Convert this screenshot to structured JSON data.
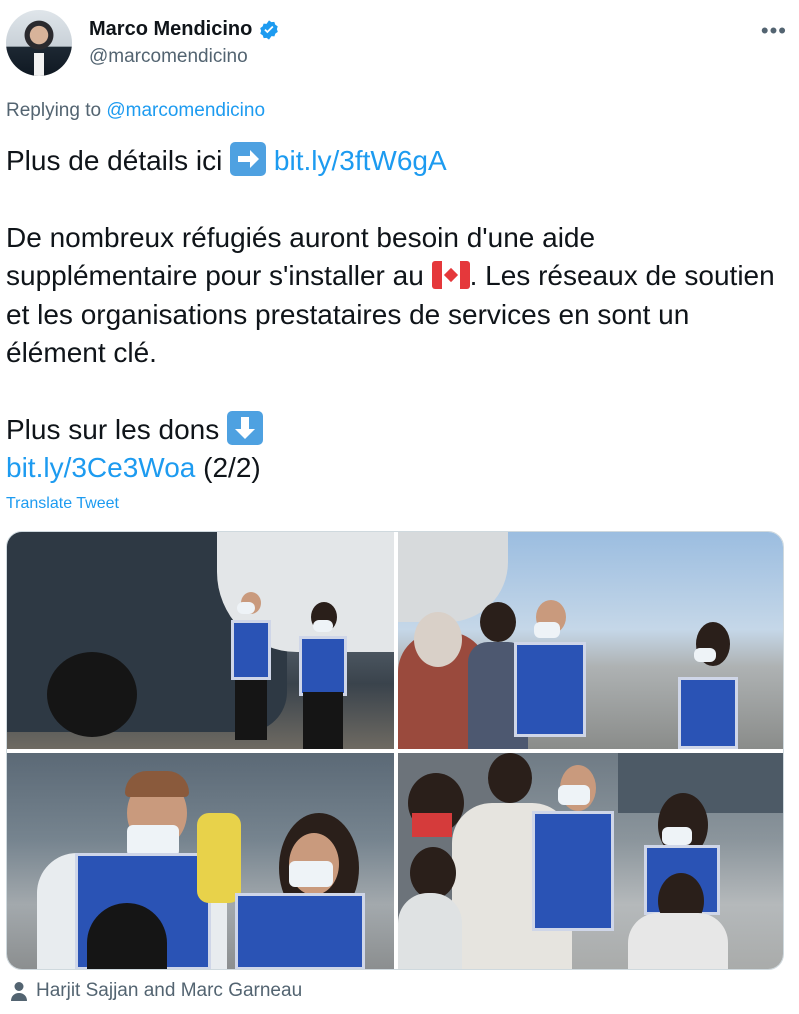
{
  "author": {
    "name": "Marco Mendicino",
    "handle": "@marcomendicino",
    "verified": true
  },
  "menu": {
    "more_icon": "more-icon"
  },
  "reply": {
    "prefix": "Replying to",
    "mention": "@marcomendicino"
  },
  "tweet": {
    "line1_text": "Plus de détails ici",
    "line1_link": "bit.ly/3ftW6gA",
    "para2_before_flag": "De nombreux réfugiés auront besoin d'une aide supplémentaire pour s'installer au",
    "para2_after_flag": ". Les réseaux de soutien et les organisations prestataires de services en sont un élément clé.",
    "line3_text": "Plus sur les dons",
    "line4_link": "bit.ly/3Ce3Woa",
    "line4_suffix": "(2/2)",
    "emoji_right_arrow": "right-arrow-emoji",
    "emoji_flag": "canada-flag-emoji",
    "emoji_down_arrow": "down-arrow-emoji"
  },
  "translate_label": "Translate Tweet",
  "media": {
    "photos": [
      {
        "name": "photo-1"
      },
      {
        "name": "photo-2"
      },
      {
        "name": "photo-3"
      },
      {
        "name": "photo-4"
      }
    ]
  },
  "tagged": {
    "icon": "person-icon",
    "text": "Harjit Sajjan and Marc Garneau"
  },
  "colors": {
    "link": "#1d9bf0",
    "secondary_text": "#536471",
    "primary_text": "#0f1419"
  }
}
